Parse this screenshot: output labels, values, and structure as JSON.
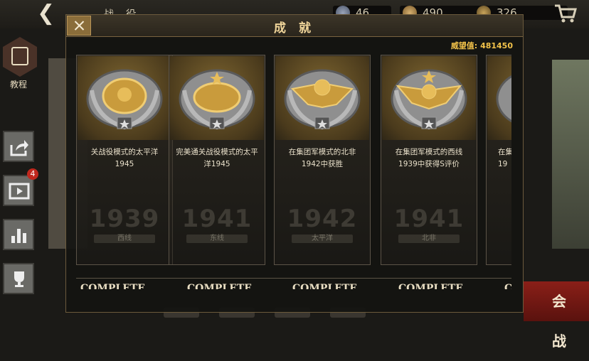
{
  "background": {
    "title": "战 役",
    "resources": [
      {
        "icon": "medal-icon",
        "value": "46"
      },
      {
        "icon": "medal-icon",
        "value": "490"
      },
      {
        "icon": "rank-badge-icon",
        "value": "326"
      }
    ],
    "sidebar": {
      "tutorial_label": "教程",
      "video_badge": "4"
    },
    "battle_button": "会 战",
    "watermarks": [
      {
        "year": "1939",
        "front": "西线"
      },
      {
        "year": "1941",
        "front": "东线"
      },
      {
        "year": "1942",
        "front": "太平洋"
      },
      {
        "year": "1941",
        "front": "北非"
      }
    ]
  },
  "dialog": {
    "title": "成 就",
    "prestige_label": "威望值:",
    "prestige_value": "481450",
    "achievements": [
      {
        "line1": "关战役模式的太平洋",
        "line2": "1945",
        "status": "COMPLETE"
      },
      {
        "line1": "完美通关战役模式的太平",
        "line2": "洋1945",
        "status": "COMPLETE"
      },
      {
        "line1": "在集团军模式的北非",
        "line2": "1942中获胜",
        "status": "COMPLETE"
      },
      {
        "line1": "在集团军模式的西线",
        "line2": "1939中获得S评价",
        "status": "COMPLETE"
      },
      {
        "line1": "在集",
        "line2": "19",
        "status": "C"
      }
    ]
  },
  "colors": {
    "gold": "#f2c24a",
    "panel": "#141311",
    "accent_red": "#8a1f18"
  }
}
